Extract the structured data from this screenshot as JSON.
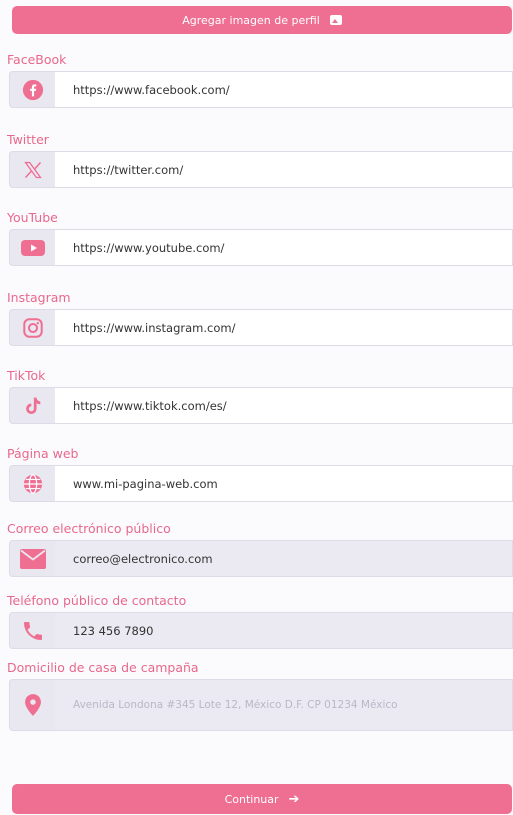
{
  "top_button": {
    "label": "Agregar imagen de perfil",
    "icon": "image-icon"
  },
  "fields": {
    "facebook": {
      "label": "FaceBook",
      "value": "https://www.facebook.com/",
      "icon": "facebook-icon"
    },
    "twitter": {
      "label": "Twitter",
      "value": "https://twitter.com/",
      "icon": "x-icon"
    },
    "youtube": {
      "label": "YouTube",
      "value": "https://www.youtube.com/",
      "icon": "youtube-icon"
    },
    "instagram": {
      "label": "Instagram",
      "value": "https://www.instagram.com/",
      "icon": "instagram-icon"
    },
    "tiktok": {
      "label": "TikTok",
      "value": "https://www.tiktok.com/es/",
      "icon": "tiktok-icon"
    },
    "website": {
      "label": "Página web",
      "value": "www.mi-pagina-web.com",
      "icon": "globe-icon"
    },
    "email": {
      "label": "Correo electrónico público",
      "value": "correo@electronico.com",
      "icon": "mail-icon"
    },
    "phone": {
      "label": "Teléfono público de contacto",
      "value": "123 456 7890",
      "icon": "phone-icon"
    },
    "address": {
      "label": "Domicilio de casa de campaña",
      "placeholder": "Avenida Londona #345 Lote 12, México D.F. CP 01234 México",
      "icon": "location-pin-icon"
    }
  },
  "continue_button": {
    "label": "Continuar",
    "icon": "arrow-right-icon"
  },
  "colors": {
    "accent": "#ef6f93",
    "label": "#e8688c",
    "icon_bg": "#e9e8f1"
  }
}
